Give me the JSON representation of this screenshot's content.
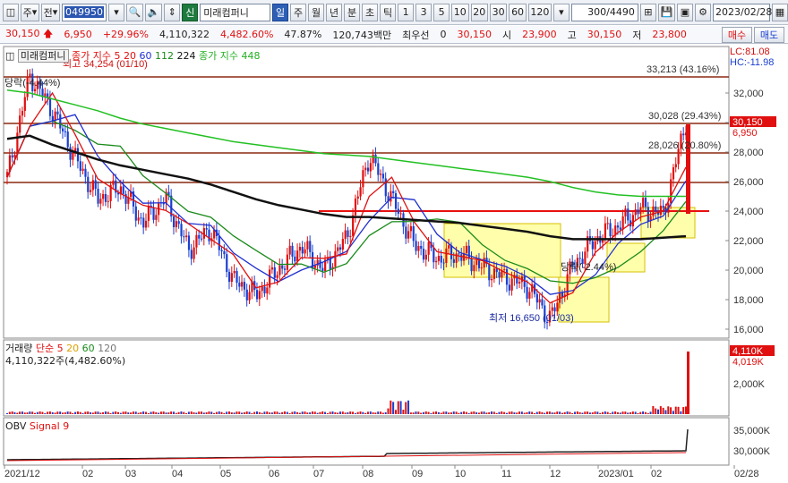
{
  "toolbar": {
    "market": "주",
    "cmp": "전",
    "code": "049950",
    "name_badge": "신",
    "name": "미래컴퍼니",
    "periods": [
      "일",
      "주",
      "월",
      "년",
      "분",
      "초",
      "틱"
    ],
    "active_period": "일",
    "nums": [
      "1",
      "3",
      "5",
      "10",
      "20",
      "30",
      "60",
      "120"
    ],
    "count": "300/4490",
    "date": "2023/02/28"
  },
  "info": {
    "price": "30,150",
    "change": "6,950",
    "rate": "+29.96%",
    "volume": "4,110,322",
    "vol_rate": "4,482.60%",
    "turnover": "47.87%",
    "amount": "120,743백만",
    "tag": "최우선",
    "zero": "0",
    "ask": "30,150",
    "open_label": "시",
    "open": "23,900",
    "high_label": "고",
    "high": "30,150",
    "low_label": "저",
    "low": "23,800",
    "buy": "매수",
    "sell": "매도"
  },
  "price_panel": {
    "title": "미래컴퍼니",
    "legend_ma": "종가 지수 5",
    "ma_periods": [
      "20",
      "60",
      "112",
      "224"
    ],
    "legend_long": "종가 지수 448",
    "lc": "LC:81.08",
    "hc": "HC:-11.98",
    "max_note": "최고 34,254 (01/10)",
    "min_note": "최저 16,650 (01/03)",
    "drop_note": "당락(-4.44%)",
    "drop_note2": "당락(-2.44%)",
    "levels": [
      {
        "v": "33,213",
        "p": "(43.16%)"
      },
      {
        "v": "30,028",
        "p": "(29.43%)"
      },
      {
        "v": "28,026",
        "p": "(20.80%)"
      }
    ],
    "y_ticks": [
      "32,000",
      "30,000",
      "28,000",
      "26,000",
      "24,000",
      "22,000",
      "20,000",
      "18,000",
      "16,000"
    ],
    "cur_price": "30,150",
    "cur_change": "6,950"
  },
  "vol_panel": {
    "title": "거래량",
    "ma_label": "단순 5",
    "ma": [
      "20",
      "60",
      "120"
    ],
    "value": "4,110,322주(4,482.60%)",
    "y_ticks": [
      "2,000K"
    ],
    "cur": "4,110K",
    "cur2": "4,019K"
  },
  "obv_panel": {
    "title": "OBV",
    "signal": "Signal 9",
    "y_ticks": [
      "35,000K",
      "30,000K"
    ]
  },
  "x_axis": [
    "2021/12",
    "02",
    "03",
    "04",
    "05",
    "06",
    "07",
    "08",
    "09",
    "10",
    "11",
    "12",
    "2023/01",
    "02",
    "02/28"
  ],
  "chart_data": {
    "type": "line",
    "series": [
      {
        "values": [
          26300,
          33200,
          30800,
          27600,
          24800,
          25600,
          23200,
          24900,
          21400,
          22800,
          19300,
          18300,
          20100,
          21600,
          20000,
          22200,
          27800,
          24800,
          21700,
          20800,
          21100,
          20200,
          19500,
          18900,
          16650,
          20300,
          22100,
          23000,
          24200,
          23800,
          30150
        ]
      },
      {
        "name": "224",
        "values": [
          28900,
          29100,
          28500,
          28000,
          27500,
          27100,
          26800,
          26500,
          26200,
          25800,
          25300,
          24800,
          24400,
          24100,
          23800,
          23600,
          23600,
          23500,
          23400,
          23300,
          23200,
          23000,
          22800,
          22600,
          22300,
          22100,
          22100,
          22100,
          22100,
          22200,
          22300
        ]
      },
      {
        "name": "448",
        "values": [
          32200,
          32000,
          31600,
          31200,
          30800,
          30300,
          29900,
          29600,
          29300,
          29000,
          28700,
          28500,
          28300,
          28100,
          27900,
          27800,
          27700,
          27500,
          27300,
          27100,
          26900,
          26700,
          26500,
          26300,
          26000,
          25600,
          25300,
          25100,
          25000,
          25000,
          25000
        ]
      }
    ],
    "volume_last": "4,110K"
  }
}
